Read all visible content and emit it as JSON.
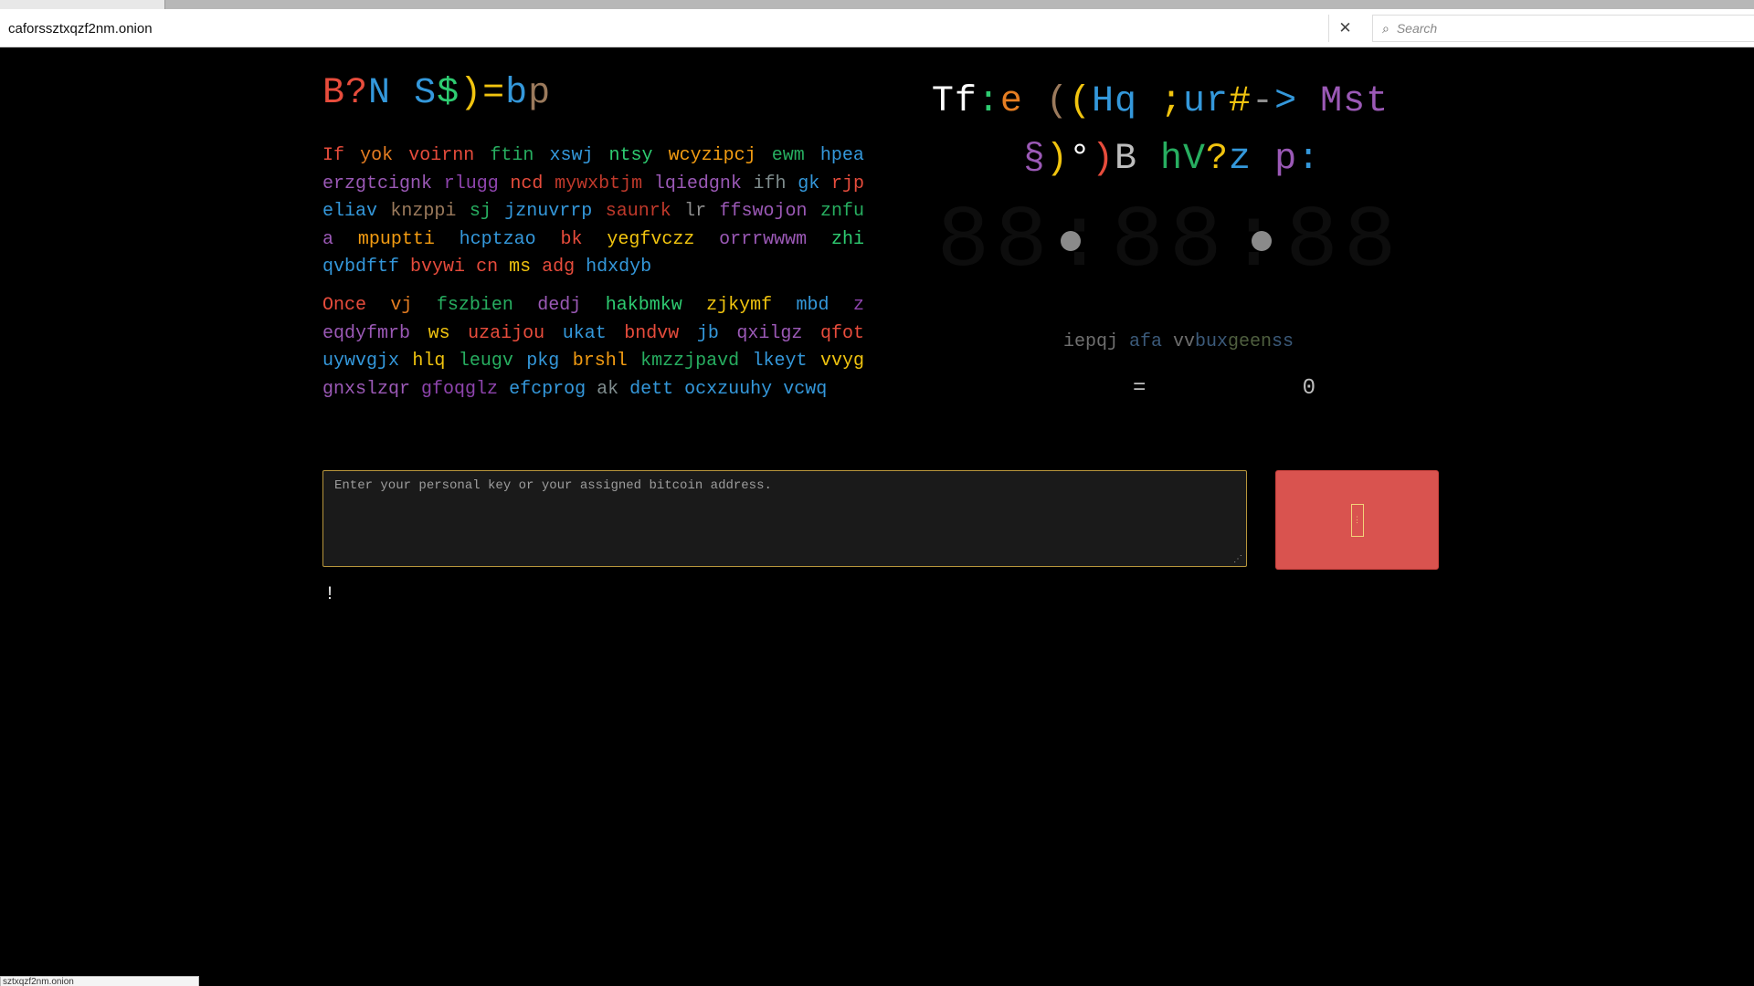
{
  "browser": {
    "address": "caforssztxqzf2nm.onion",
    "search_placeholder": "Search",
    "status_url": "sztxqzf2nm.onion"
  },
  "left_title": [
    {
      "t": "B",
      "c": "#e74c3c"
    },
    {
      "t": "?",
      "c": "#e74c3c"
    },
    {
      "t": "N",
      "c": "#3498db"
    },
    {
      "t": " ",
      "c": "#fff"
    },
    {
      "t": "S",
      "c": "#3498db"
    },
    {
      "t": "$",
      "c": "#2ecc71"
    },
    {
      "t": ")",
      "c": "#f1c40f"
    },
    {
      "t": "=",
      "c": "#f1c40f"
    },
    {
      "t": "b",
      "c": "#3498db"
    },
    {
      "t": "p",
      "c": "#9b7a5c"
    }
  ],
  "paragraph1": [
    {
      "t": "If",
      "c": "#e74c3c"
    },
    {
      "t": "yok",
      "c": "#e67e22"
    },
    {
      "t": "voirnn",
      "c": "#e74c3c"
    },
    {
      "t": "ftin",
      "c": "#27ae60"
    },
    {
      "t": "xswj",
      "c": "#3498db"
    },
    {
      "t": "ntsy",
      "c": "#2ecc71"
    },
    {
      "t": "wcyzipcj",
      "c": "#f39c12"
    },
    {
      "t": "ewm",
      "c": "#27ae60"
    },
    {
      "t": "hpea",
      "c": "#3498db"
    },
    {
      "t": "erzgtcignk",
      "c": "#9b59b6"
    },
    {
      "t": "rlugg",
      "c": "#8e44ad"
    },
    {
      "t": "ncd",
      "c": "#e74c3c"
    },
    {
      "t": "mywxbtjm",
      "c": "#c0392b"
    },
    {
      "t": "lqiedgnk",
      "c": "#9b59b6"
    },
    {
      "t": "ifh",
      "c": "#7f8c8d"
    },
    {
      "t": "gk",
      "c": "#3498db"
    },
    {
      "t": "rjp",
      "c": "#e74c3c"
    },
    {
      "t": "eliav",
      "c": "#3498db"
    },
    {
      "t": "knzppi",
      "c": "#9b7a5c"
    },
    {
      "t": "sj",
      "c": "#27ae60"
    },
    {
      "t": "jznuvrrp",
      "c": "#3498db"
    },
    {
      "t": "saunrk",
      "c": "#c0392b"
    },
    {
      "t": "lr",
      "c": "#8e8e8e"
    },
    {
      "t": "ffswojon",
      "c": "#9b59b6"
    },
    {
      "t": "znfu",
      "c": "#27ae60"
    },
    {
      "t": "a",
      "c": "#9b59b6"
    },
    {
      "t": "mpuptti",
      "c": "#f39c12"
    },
    {
      "t": "hcptzao",
      "c": "#3498db"
    },
    {
      "t": "bk",
      "c": "#e74c3c"
    },
    {
      "t": "yegfvczz",
      "c": "#f1c40f"
    },
    {
      "t": "orrrwwwm",
      "c": "#9b59b6"
    },
    {
      "t": "zhi",
      "c": "#2ecc71"
    },
    {
      "t": "qvbdftf",
      "c": "#3498db"
    },
    {
      "t": "bvywi",
      "c": "#e74c3c"
    },
    {
      "t": "cn",
      "c": "#e74c3c"
    },
    {
      "t": "ms",
      "c": "#f1c40f"
    },
    {
      "t": "adg",
      "c": "#e74c3c"
    },
    {
      "t": "hdxdyb",
      "c": "#3498db"
    }
  ],
  "paragraph2": [
    {
      "t": "Once",
      "c": "#e74c3c"
    },
    {
      "t": "vj",
      "c": "#e67e22"
    },
    {
      "t": "fszbien",
      "c": "#27ae60"
    },
    {
      "t": "dedj",
      "c": "#9b59b6"
    },
    {
      "t": "hakbmkw",
      "c": "#2ecc71"
    },
    {
      "t": "zjkymf",
      "c": "#f1c40f"
    },
    {
      "t": "mbd",
      "c": "#3498db"
    },
    {
      "t": "z",
      "c": "#8e44ad"
    },
    {
      "t": "eqdyfmrb",
      "c": "#9b59b6"
    },
    {
      "t": "ws",
      "c": "#f1c40f"
    },
    {
      "t": "uzaijou",
      "c": "#e74c3c"
    },
    {
      "t": "ukat",
      "c": "#3498db"
    },
    {
      "t": "bndvw",
      "c": "#e74c3c"
    },
    {
      "t": "jb",
      "c": "#3498db"
    },
    {
      "t": "qxilgz",
      "c": "#9b59b6"
    },
    {
      "t": "qfot",
      "c": "#e74c3c"
    },
    {
      "t": "uywvgjx",
      "c": "#3498db"
    },
    {
      "t": "hlq",
      "c": "#f1c40f"
    },
    {
      "t": "leugv",
      "c": "#27ae60"
    },
    {
      "t": "pkg",
      "c": "#3498db"
    },
    {
      "t": "brshl",
      "c": "#f39c12"
    },
    {
      "t": "kmzzjpavd",
      "c": "#27ae60"
    },
    {
      "t": "lkeyt",
      "c": "#3498db"
    },
    {
      "t": "vvyg",
      "c": "#f1c40f"
    },
    {
      "t": "gnxslzqr",
      "c": "#9b59b6"
    },
    {
      "t": "gfoqglz",
      "c": "#8e44ad"
    },
    {
      "t": "efcprog",
      "c": "#3498db"
    },
    {
      "t": "ak",
      "c": "#7f8c8d"
    },
    {
      "t": "dett",
      "c": "#3498db"
    },
    {
      "t": "ocxzuuhy",
      "c": "#3498db"
    },
    {
      "t": "vcwq",
      "c": "#3498db"
    }
  ],
  "right_title": [
    {
      "t": "Tf",
      "c": "#ffffff"
    },
    {
      "t": ":",
      "c": "#2ecc71"
    },
    {
      "t": "e",
      "c": "#e67e22"
    },
    {
      "t": " ",
      "c": "#fff"
    },
    {
      "t": "(",
      "c": "#9b7a5c"
    },
    {
      "t": "(",
      "c": "#f1c40f"
    },
    {
      "t": "Hq",
      "c": "#3498db"
    },
    {
      "t": " ",
      "c": "#fff"
    },
    {
      "t": ";",
      "c": "#f1c40f"
    },
    {
      "t": "ur",
      "c": "#3498db"
    },
    {
      "t": "#",
      "c": "#f1c40f"
    },
    {
      "t": "-",
      "c": "#8e8e8e"
    },
    {
      "t": ">",
      "c": "#3498db"
    },
    {
      "t": " ",
      "c": "#fff"
    },
    {
      "t": "Mst",
      "c": "#9b59b6"
    },
    {
      "t": " ",
      "c": "#fff"
    },
    {
      "t": "§",
      "c": "#9b59b6"
    },
    {
      "t": ")",
      "c": "#f1c40f"
    },
    {
      "t": "°",
      "c": "#ffffff"
    },
    {
      "t": ")",
      "c": "#e74c3c"
    },
    {
      "t": "B",
      "c": "#bdbdbd"
    },
    {
      "t": " ",
      "c": "#fff"
    },
    {
      "t": "hV",
      "c": "#27ae60"
    },
    {
      "t": "?",
      "c": "#f1c40f"
    },
    {
      "t": "z",
      "c": "#3498db"
    },
    {
      "t": " ",
      "c": "#fff"
    },
    {
      "t": "p",
      "c": "#9b59b6"
    },
    {
      "t": ":",
      "c": "#3498db"
    }
  ],
  "timer": {
    "display": "88:88:88"
  },
  "timer_label": [
    {
      "t": "iepqj",
      "c": "#6f6f6f"
    },
    {
      "t": " ",
      "c": "#fff"
    },
    {
      "t": "afa",
      "c": "#3b5a7a"
    },
    {
      "t": " ",
      "c": "#fff"
    },
    {
      "t": "vv",
      "c": "#6f6f6f"
    },
    {
      "t": "bux",
      "c": "#3b5a7a"
    },
    {
      "t": "geen",
      "c": "#4f5f3f"
    },
    {
      "t": "ss",
      "c": "#3b5a7a"
    }
  ],
  "btc": {
    "sign": "=",
    "amount": "0"
  },
  "input": {
    "placeholder": "Enter your personal key or your assigned bitcoin address."
  },
  "message": "!"
}
